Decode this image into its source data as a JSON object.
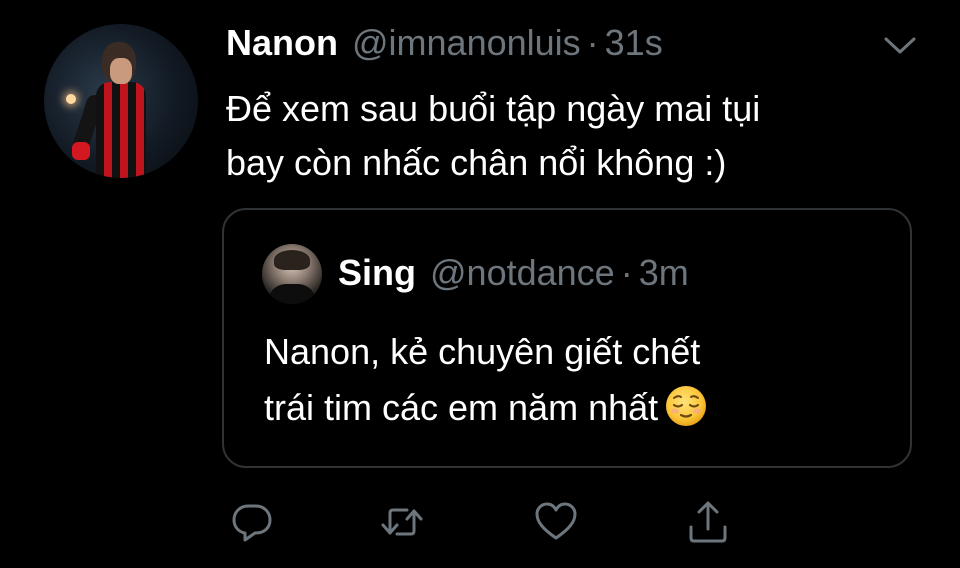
{
  "tweet": {
    "display_name": "Nanon",
    "handle": "@imnanonluis",
    "separator": "·",
    "time": "31s",
    "avatar_icon": "user-avatar-icon",
    "text_line1": "Để xem sau buổi tập ngày mai tụi",
    "text_line2": "bay còn nhấc chân nổi không :)"
  },
  "quoted": {
    "display_name": "Sing",
    "handle": "@notdance",
    "separator": "·",
    "time": "3m",
    "avatar_icon": "user-avatar-icon",
    "text_line1": "Nanon, kẻ chuyên giết chết",
    "text_line2": "trái tim các em năm nhất",
    "emoji_icon": "relieved-face-emoji-icon"
  },
  "actions": {
    "reply_icon": "reply-icon",
    "retweet_icon": "retweet-icon",
    "like_icon": "heart-icon",
    "share_icon": "share-icon",
    "menu_icon": "chevron-down-icon"
  },
  "colors": {
    "background": "#000000",
    "primary_text": "#ffffff",
    "secondary_text": "#6e767d",
    "border": "#2f3336",
    "icon": "#6e767d"
  }
}
